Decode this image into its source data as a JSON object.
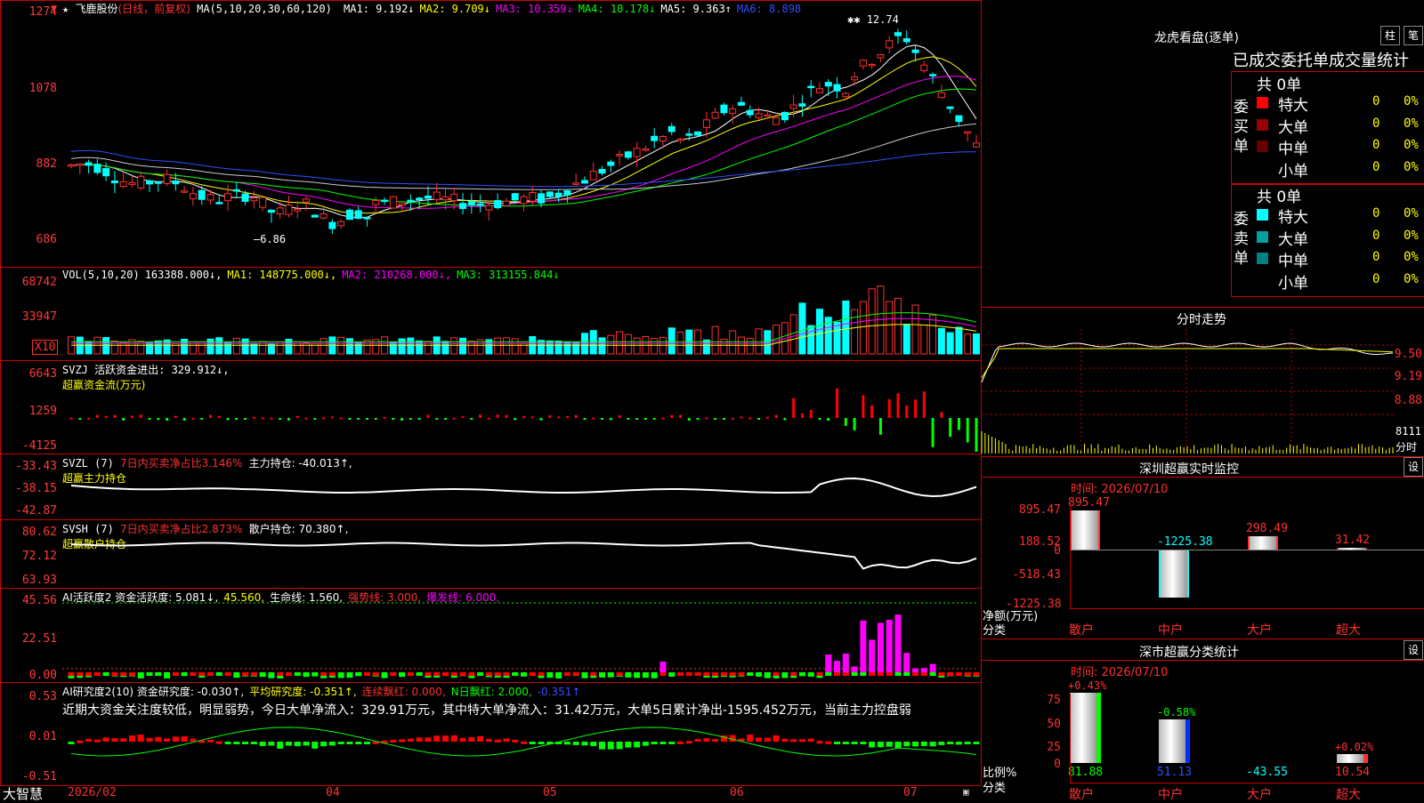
{
  "main_chart": {
    "star": "★",
    "stock_name": "飞鹿股份",
    "mode": "(日线，前复权)",
    "ma_header": "MA(5,10,20,30,60,120)",
    "ma_values": [
      {
        "label": "MA1: 9.192↓",
        "color": "#ffffff"
      },
      {
        "label": "MA2: 9.709↓",
        "color": "#ffff00"
      },
      {
        "label": "MA3: 10.359↓",
        "color": "#ff00ff"
      },
      {
        "label": "MA4: 10.178↓",
        "color": "#00ff00"
      },
      {
        "label": "MA5: 9.363↑",
        "color": "#ffffff"
      },
      {
        "label": "MA6: 8.898",
        "color": "#3050ff"
      }
    ],
    "y_ticks": [
      "1274",
      "1078",
      "882",
      "686"
    ],
    "peak_label": "12.74",
    "low_label": "6.86"
  },
  "volume": {
    "header_parts": [
      {
        "text": "VOL(5,10,20)",
        "color": "#ffffff"
      },
      {
        "text": "163388.000↓,",
        "color": "#ffffff"
      },
      {
        "text": "MA1: 148775.000↓,",
        "color": "#ffff00"
      },
      {
        "text": "MA2: 210268.000↓,",
        "color": "#ff00ff"
      },
      {
        "text": "MA3: 313155.844↓",
        "color": "#00ff00"
      }
    ],
    "y_ticks": [
      "68742",
      "33947"
    ],
    "unit_label": "X10"
  },
  "svzj": {
    "line1": "SVZJ  活跃资金进出: 329.912↓,",
    "line2": "超赢资金流(万元)",
    "y_ticks": [
      "6643",
      "1259",
      "-4125"
    ]
  },
  "svzl": {
    "name": "SVZL (7)",
    "pct": "7日内买卖净占比3.146%",
    "holding": "主力持仓: -40.013↑,",
    "line2": "超赢主力持仓",
    "y_ticks": [
      "-33.43",
      "-38.15",
      "-42.87"
    ]
  },
  "svsh": {
    "name": "SVSH (7)",
    "pct": "7日内买卖净占比2.873%",
    "holding": "散户持仓: 70.380↑,",
    "line2": "超赢散户持仓",
    "y_ticks": [
      "80.62",
      "72.12",
      "63.93"
    ]
  },
  "ai_active": {
    "parts": [
      {
        "text": "AI活跃度2 资金活跃度: 5.081↓,",
        "color": "#ffffff"
      },
      {
        "text": "45.560,",
        "color": "#ffff00"
      },
      {
        "text": "生命线: 1.560,",
        "color": "#ffffff"
      },
      {
        "text": "强势线: 3.000,",
        "color": "#ff3030"
      },
      {
        "text": "爆发线: 6.000,",
        "color": "#ff00ff"
      }
    ],
    "y_ticks": [
      "45.56",
      "22.51",
      "0.00"
    ]
  },
  "ai_research": {
    "parts": [
      {
        "text": "AI研究度2(10) 资金研究度: -0.030↑,",
        "color": "#ffffff"
      },
      {
        "text": "平均研究度: -0.351↑,",
        "color": "#ffff00"
      },
      {
        "text": "连续飘红: 0.000,",
        "color": "#ff3030"
      },
      {
        "text": "N日飘红: 2.000,",
        "color": "#00ff00"
      },
      {
        "text": "-0.351↑",
        "color": "#3050ff"
      }
    ],
    "comment": "近期大资金关注度较低，明显弱势，今日大单净流入：329.91万元，其中特大单净流入：31.42万元，大单5日累计净出-1595.452万元，当前主力控盘弱",
    "y_ticks": [
      "0.53",
      "0.01",
      "-0.51"
    ]
  },
  "x_axis": {
    "labels": [
      "2026/02",
      "04",
      "05",
      "06",
      "07"
    ],
    "brand": "大智慧"
  },
  "longhu": {
    "title": "龙虎看盘(逐单)",
    "btn_bar": "柱",
    "btn_line": "笔",
    "tabs": "已成交委托单成交量统计",
    "buy_side": "委买单",
    "sell_side": "委卖单",
    "buy_total": "共 0单",
    "sell_total": "共 0单",
    "buy_rows": [
      {
        "label": "特大",
        "count": "0",
        "pct": "0%",
        "color": "#ff0000"
      },
      {
        "label": "大单",
        "count": "0",
        "pct": "0%",
        "color": "#990000"
      },
      {
        "label": "中单",
        "count": "0",
        "pct": "0%",
        "color": "#660000"
      },
      {
        "label": "小单",
        "count": "0",
        "pct": "0%",
        "color": "#000000"
      }
    ],
    "sell_rows": [
      {
        "label": "特大",
        "count": "0",
        "pct": "0%",
        "color": "#00ffff"
      },
      {
        "label": "大单",
        "count": "0",
        "pct": "0%",
        "color": "#00a0a0"
      },
      {
        "label": "中单",
        "count": "0",
        "pct": "0%",
        "color": "#008080"
      },
      {
        "label": "小单",
        "count": "0",
        "pct": "0%",
        "color": "#000000"
      }
    ]
  },
  "intraday": {
    "title": "分时走势",
    "y_ticks": [
      "9.50",
      "9.19",
      "8.88"
    ],
    "vol_label": "8111",
    "bottom_label": "分时"
  },
  "sz_monitor": {
    "title": "深圳超赢实时监控",
    "btn": "设",
    "time": "时间: 2026/07/10",
    "y_ticks": [
      "895.47",
      "188.52",
      "0",
      "-518.43",
      "-1225.38"
    ],
    "axis_title": "净额(万元)",
    "axis_sub": "分类",
    "bars": [
      {
        "label": "散户",
        "value": 895.47,
        "display": "895.47",
        "color": "#ff3030"
      },
      {
        "label": "中户",
        "value": -1225.38,
        "display": "-1225.38",
        "color": "#00ffff"
      },
      {
        "label": "大户",
        "value": 298.49,
        "display": "298.49",
        "color": "#ff3030"
      },
      {
        "label": "超大",
        "value": 31.42,
        "display": "31.42",
        "color": "#ff3030"
      }
    ]
  },
  "sz_class": {
    "title": "深市超赢分类统计",
    "btn": "设",
    "time": "时间: 2026/07/10",
    "y_ticks": [
      "75",
      "50",
      "25",
      "0"
    ],
    "axis_title": "比例%",
    "axis_sub": "分类",
    "bars": [
      {
        "label": "散户",
        "pct": "+0.43%",
        "value": "81.88",
        "pct_color": "#ff3030",
        "val_color": "#00ff00"
      },
      {
        "label": "中户",
        "pct": "-0.58%",
        "value": "51.13",
        "pct_color": "#00ff00",
        "val_color": "#3050ff"
      },
      {
        "label": "大户",
        "pct": "",
        "value": "-43.55",
        "pct_color": "#ff3030",
        "val_color": "#00ffff"
      },
      {
        "label": "超大",
        "pct": "+0.02%",
        "value": "10.54",
        "pct_color": "#ff3030",
        "val_color": "#ff3030"
      }
    ],
    "heights": [
      82,
      51,
      0,
      10
    ]
  },
  "colors": {
    "up": "#ff3030",
    "down": "#00ffff",
    "border": "#c80000"
  }
}
